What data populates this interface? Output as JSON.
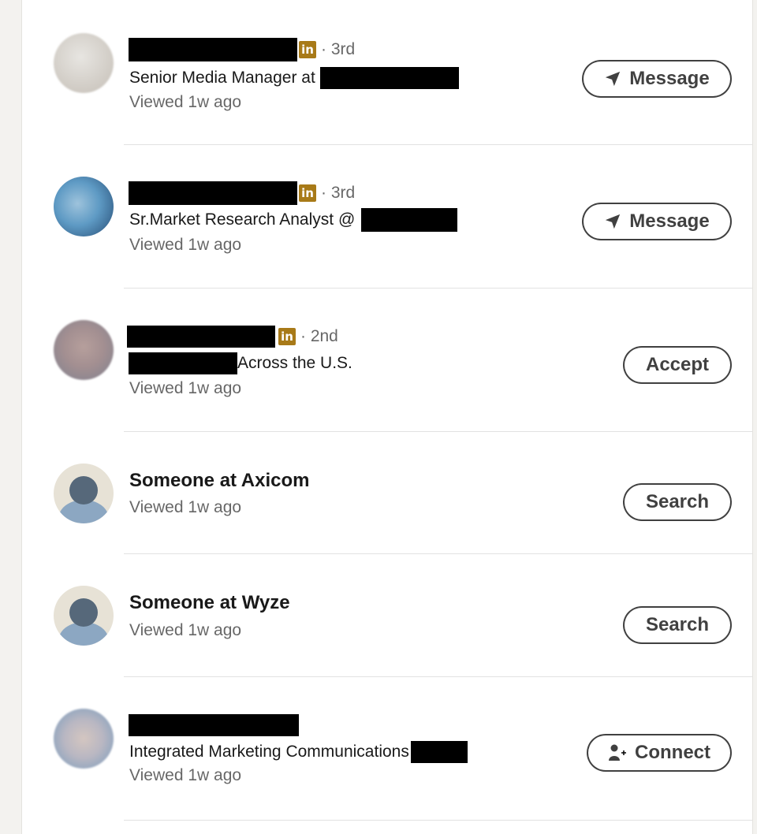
{
  "rows": [
    {
      "degree": "· 3rd",
      "headline": "Senior Media Manager at",
      "viewed": "Viewed 1w ago",
      "action": "Message",
      "action_icon": "send-icon"
    },
    {
      "degree": "· 3rd",
      "headline": "Sr.Market Research Analyst @",
      "viewed": "Viewed 1w ago",
      "action": "Message",
      "action_icon": "send-icon"
    },
    {
      "degree": "· 2nd",
      "headline": "Across the U.S.",
      "viewed": "Viewed 1w ago",
      "action": "Accept"
    },
    {
      "title": "Someone at Axicom",
      "viewed": "Viewed 1w ago",
      "action": "Search"
    },
    {
      "title": "Someone at Wyze",
      "viewed": "Viewed 1w ago",
      "action": "Search"
    },
    {
      "headline": "Integrated Marketing Communications",
      "viewed": "Viewed 1w ago",
      "action": "Connect",
      "action_icon": "person-add-icon"
    }
  ],
  "linkedin_badge_text": "in",
  "colors": {
    "badge": "#a87a18",
    "page_bg": "#f3f2ef",
    "divider": "#e2e2e2"
  }
}
